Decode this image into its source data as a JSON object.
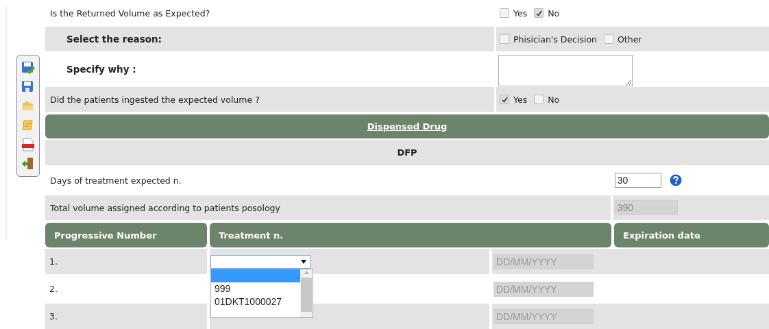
{
  "questions": [
    {
      "kind": "choices",
      "label": "Is the Returned Volume as Expected?",
      "indented": false,
      "options": [
        {
          "label": "Yes",
          "checked": false
        },
        {
          "label": "No",
          "checked": true
        }
      ]
    },
    {
      "kind": "choices",
      "label": "Select the reason:",
      "indented": true,
      "options": [
        {
          "label": "Phisician's Decision",
          "checked": false
        },
        {
          "label": "Other",
          "checked": false
        }
      ]
    },
    {
      "kind": "textarea",
      "label": "Specify why :",
      "indented": true
    },
    {
      "kind": "choices",
      "label": "Did the patients ingested the expected volume ?",
      "indented": false,
      "options": [
        {
          "label": "Yes",
          "checked": true
        },
        {
          "label": "No",
          "checked": false
        }
      ]
    }
  ],
  "section": {
    "title": "Dispensed Drug"
  },
  "drug": "DFP",
  "fields": [
    {
      "label": "Days of treatment expected n.",
      "value": "30",
      "disabled": false,
      "help": true
    },
    {
      "label": "Total volume assigned according to patients posology",
      "value": "390",
      "disabled": true,
      "help": false
    }
  ],
  "table": {
    "columns": [
      "Progressive Number",
      "Treatment n.",
      "Expiration date"
    ],
    "rows": [
      {
        "number": "1.",
        "treatment": {
          "open": true
        },
        "date": {
          "placeholder": "DD/MM/YYYY",
          "disabled": true
        }
      },
      {
        "number": "2.",
        "date": {
          "placeholder": "DD/MM/YYYY",
          "disabled": true
        }
      },
      {
        "number": "3.",
        "date": {
          "placeholder": "DD/MM/YYYY",
          "disabled": true
        }
      }
    ]
  },
  "dropdown": {
    "options": [
      {
        "selected": true
      },
      {
        "label": "999",
        "selected": false
      },
      {
        "label": "01DKT1000027",
        "selected": false
      }
    ]
  }
}
